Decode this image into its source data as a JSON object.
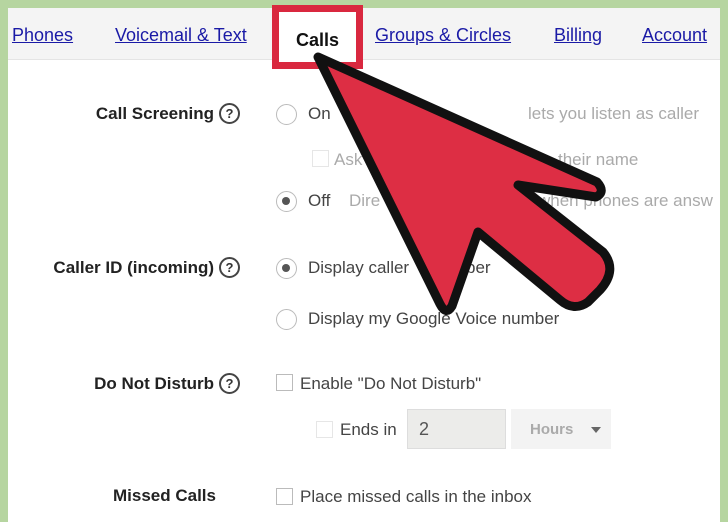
{
  "tabs": [
    "Phones",
    "Voicemail & Text",
    "Calls",
    "Groups & Circles",
    "Billing",
    "Account"
  ],
  "active_tab": "Calls",
  "call_screening": {
    "label": "Call Screening",
    "help": "?",
    "on_label": "On",
    "on_desc": "lets you listen as caller",
    "ask_label": "Ask",
    "ask_desc": "their name",
    "off_label": "Off",
    "off_desc_start": "Dire",
    "off_desc_end": "when phones are answ",
    "selected": "Off"
  },
  "caller_id": {
    "label": "Caller ID (incoming)",
    "help": "?",
    "opt1": "Display caller",
    "opt1_end": "ber",
    "opt2": "Display my Google Voice number",
    "selected": "Display caller number"
  },
  "dnd": {
    "label": "Do Not Disturb",
    "help": "?",
    "enable_label": "Enable \"Do Not Disturb\"",
    "ends_label": "Ends in",
    "ends_value": "2",
    "unit": "Hours"
  },
  "missed": {
    "label": "Missed Calls",
    "opt": "Place missed calls in the inbox"
  },
  "colors": {
    "highlight": "#d9283f",
    "background": "#b6d5a0",
    "link": "#1a1aa6"
  }
}
